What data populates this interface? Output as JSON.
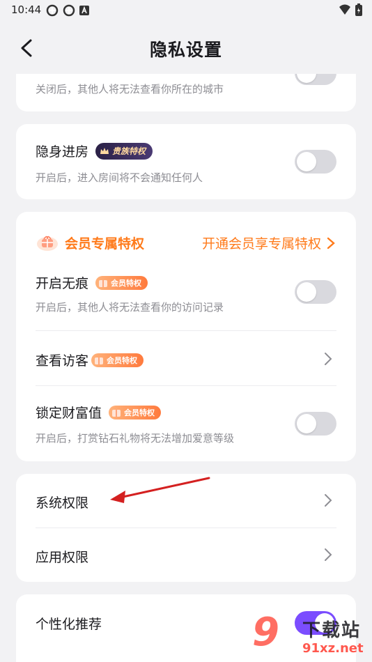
{
  "status_bar": {
    "time": "10:44"
  },
  "header": {
    "title": "隐私设置"
  },
  "city_card": {
    "subtitle": "关闭后，其他人将无法查看你所在的城市"
  },
  "invisible_card": {
    "title": "隐身进房",
    "badge": "贵族特权",
    "subtitle": "开启后，进入房间将不会通知任何人"
  },
  "vip_card": {
    "head_title": "会员专属特权",
    "head_link": "开通会员享专属特权",
    "items": [
      {
        "title": "开启无痕",
        "badge": "会员特权",
        "subtitle": "开启后，其他人将无法查看你的访问记录"
      },
      {
        "title": "查看访客",
        "badge": "会员特权"
      },
      {
        "title": "锁定财富值",
        "badge": "会员特权",
        "subtitle": "开启后，打赏钻石礼物将无法增加爱意等级"
      }
    ]
  },
  "permissions_card": {
    "items": [
      {
        "label": "系统权限"
      },
      {
        "label": "应用权限"
      }
    ]
  },
  "recommend_card": {
    "label": "个性化推荐",
    "toggle_on": true
  },
  "watermark": {
    "big": "9",
    "cn": "下载站",
    "url": "91xz.net"
  },
  "colors": {
    "accent": "#7b4dff",
    "vip_orange": "#ff7a1a",
    "arrow": "#d42020"
  }
}
